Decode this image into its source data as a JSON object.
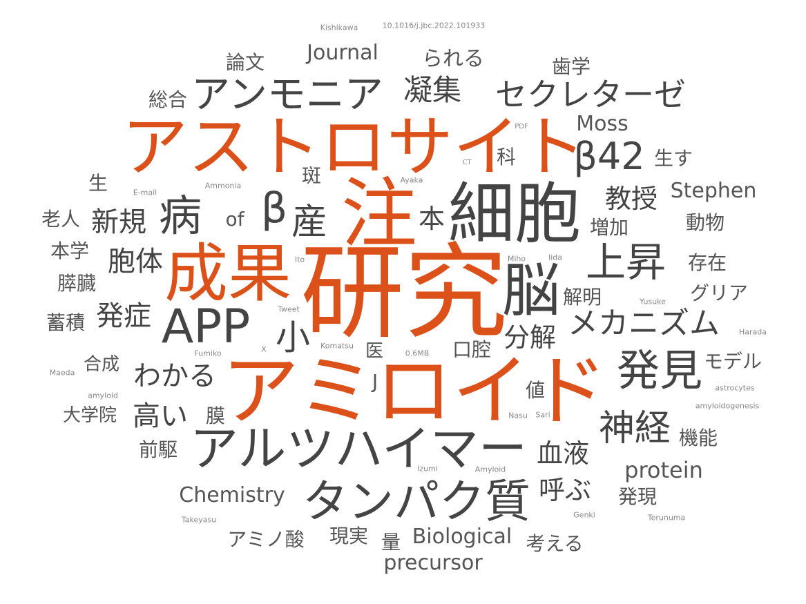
{
  "colors": {
    "accent": "#dc5019",
    "dark": "#444444",
    "medium": "#555555",
    "light": "#888888",
    "background": "#ffffff"
  },
  "words": [
    {
      "text": "研究",
      "color": "orange"
    },
    {
      "text": "アミロイド",
      "color": "orange"
    },
    {
      "text": "アストロサイト",
      "color": "orange"
    },
    {
      "text": "注",
      "color": "orange"
    },
    {
      "text": "成果",
      "color": "orange"
    },
    {
      "text": "細胞",
      "color": "dark"
    },
    {
      "text": "脳",
      "color": "dark"
    },
    {
      "text": "アルツハイマー",
      "color": "dark"
    },
    {
      "text": "タンパク質",
      "color": "dark"
    },
    {
      "text": "APP",
      "color": "dark"
    },
    {
      "text": "病",
      "color": "dark"
    },
    {
      "text": "発見",
      "color": "dark"
    },
    {
      "text": "上昇",
      "color": "dark"
    },
    {
      "text": "アンモニア",
      "color": "dark"
    },
    {
      "text": "β42",
      "color": "dark"
    },
    {
      "text": "β",
      "color": "dark"
    },
    {
      "text": "産",
      "color": "dark"
    },
    {
      "text": "神経",
      "color": "dark"
    },
    {
      "text": "セクレターゼ",
      "color": "dark"
    },
    {
      "text": "メカニズム",
      "color": "dark"
    },
    {
      "text": "小",
      "color": "dark"
    },
    {
      "text": "凝集",
      "color": "dark"
    },
    {
      "text": "新規",
      "color": "dark"
    },
    {
      "text": "胞体",
      "color": "dark"
    },
    {
      "text": "発症",
      "color": "dark"
    },
    {
      "text": "わかる",
      "color": "dark"
    },
    {
      "text": "高い",
      "color": "dark"
    },
    {
      "text": "分解",
      "color": "dark"
    },
    {
      "text": "教授",
      "color": "dark"
    },
    {
      "text": "血液",
      "color": "dark"
    },
    {
      "text": "呼ぶ",
      "color": "dark"
    },
    {
      "text": "本",
      "color": "dark"
    },
    {
      "text": "Journal",
      "color": "medium"
    },
    {
      "text": "られる",
      "color": "medium"
    },
    {
      "text": "論文",
      "color": "medium"
    },
    {
      "text": "歯学",
      "color": "medium"
    },
    {
      "text": "総合",
      "color": "medium"
    },
    {
      "text": "Moss",
      "color": "medium"
    },
    {
      "text": "科",
      "color": "medium"
    },
    {
      "text": "生す",
      "color": "medium"
    },
    {
      "text": "斑",
      "color": "medium"
    },
    {
      "text": "生",
      "color": "medium"
    },
    {
      "text": "Stephen",
      "color": "medium"
    },
    {
      "text": "老人",
      "color": "medium"
    },
    {
      "text": "of",
      "color": "medium"
    },
    {
      "text": "増加",
      "color": "medium"
    },
    {
      "text": "動物",
      "color": "medium"
    },
    {
      "text": "本学",
      "color": "medium"
    },
    {
      "text": "存在",
      "color": "medium"
    },
    {
      "text": "膵臓",
      "color": "medium"
    },
    {
      "text": "解明",
      "color": "medium"
    },
    {
      "text": "グリア",
      "color": "medium"
    },
    {
      "text": "蓄積",
      "color": "medium"
    },
    {
      "text": "医",
      "color": "medium"
    },
    {
      "text": "口腔",
      "color": "medium"
    },
    {
      "text": "モデル",
      "color": "medium"
    },
    {
      "text": "合成",
      "color": "medium"
    },
    {
      "text": "J",
      "color": "medium"
    },
    {
      "text": "値",
      "color": "medium"
    },
    {
      "text": "大学院",
      "color": "medium"
    },
    {
      "text": "膜",
      "color": "medium"
    },
    {
      "text": "機能",
      "color": "medium"
    },
    {
      "text": "前駆",
      "color": "medium"
    },
    {
      "text": "protein",
      "color": "medium"
    },
    {
      "text": "Chemistry",
      "color": "medium"
    },
    {
      "text": "発現",
      "color": "medium"
    },
    {
      "text": "アミノ酸",
      "color": "medium"
    },
    {
      "text": "現実",
      "color": "medium"
    },
    {
      "text": "量",
      "color": "medium"
    },
    {
      "text": "Biological",
      "color": "medium"
    },
    {
      "text": "考える",
      "color": "medium"
    },
    {
      "text": "precursor",
      "color": "medium"
    },
    {
      "text": "Kishikawa",
      "color": "light"
    },
    {
      "text": "10.1016/j.jbc.2022.101933",
      "color": "light"
    },
    {
      "text": "PDF",
      "color": "light"
    },
    {
      "text": "CT",
      "color": "light"
    },
    {
      "text": "Ayaka",
      "color": "light"
    },
    {
      "text": "E-mail",
      "color": "light"
    },
    {
      "text": "Ammonia",
      "color": "light"
    },
    {
      "text": "Ito",
      "color": "light"
    },
    {
      "text": "Miho",
      "color": "light"
    },
    {
      "text": "Iida",
      "color": "light"
    },
    {
      "text": "Tweet",
      "color": "light"
    },
    {
      "text": "Yusuke",
      "color": "light"
    },
    {
      "text": "Harada",
      "color": "light"
    },
    {
      "text": "Fumiko",
      "color": "light"
    },
    {
      "text": "X",
      "color": "light"
    },
    {
      "text": "Komatsu",
      "color": "light"
    },
    {
      "text": "0.6MB",
      "color": "light"
    },
    {
      "text": "Maeda",
      "color": "light"
    },
    {
      "text": "amyloid",
      "color": "light"
    },
    {
      "text": "astrocytes",
      "color": "light"
    },
    {
      "text": "amyloidogenesis",
      "color": "light"
    },
    {
      "text": "Nasu",
      "color": "light"
    },
    {
      "text": "Sari",
      "color": "light"
    },
    {
      "text": "Izumi",
      "color": "light"
    },
    {
      "text": "Amyloid",
      "color": "light"
    },
    {
      "text": "Genki",
      "color": "light"
    },
    {
      "text": "Terunuma",
      "color": "light"
    },
    {
      "text": "Takeyasu",
      "color": "light"
    }
  ]
}
